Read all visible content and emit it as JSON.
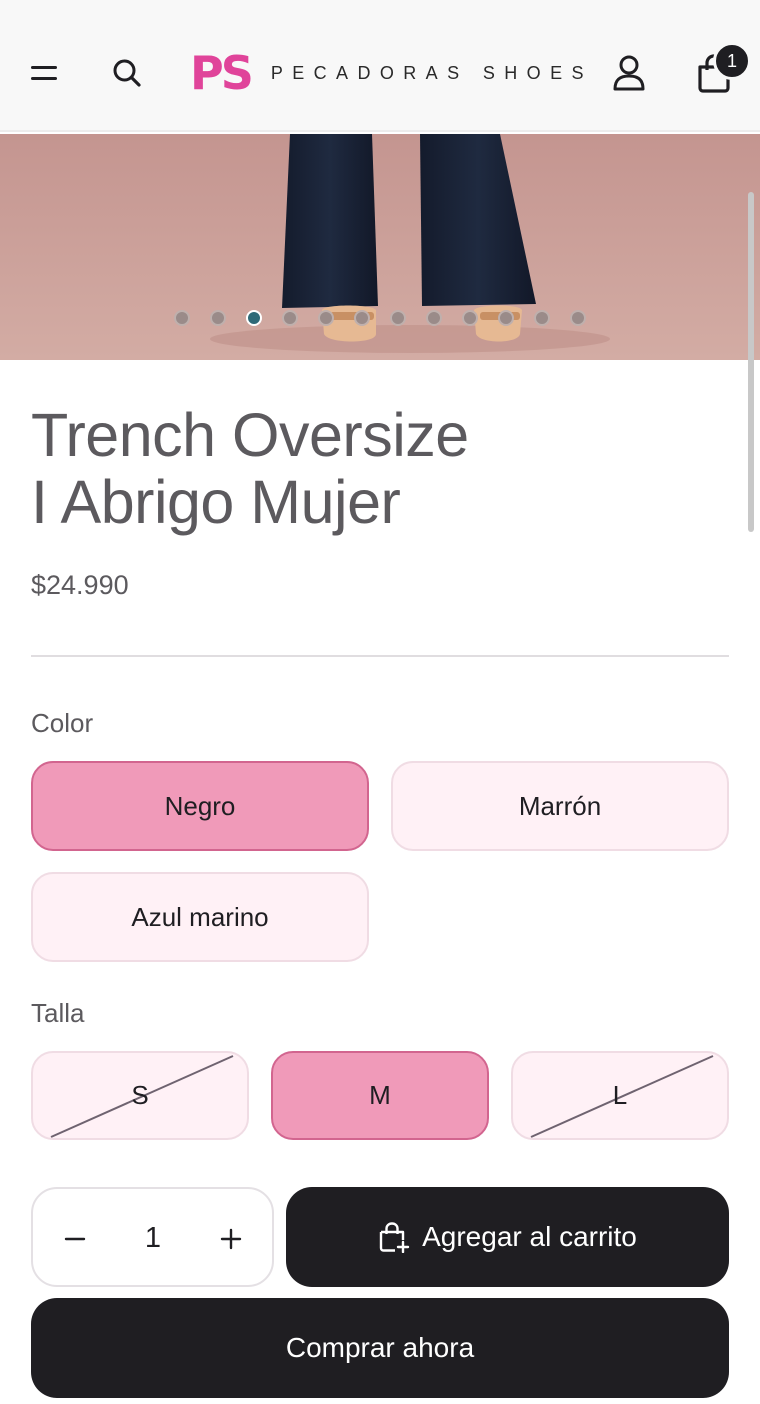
{
  "header": {
    "logo_mark": "PS",
    "logo_text": "PECADORAS SHOES",
    "cart_count": "1",
    "icons": {
      "menu": "hamburger-menu-icon",
      "search": "search-icon",
      "account": "user-account-icon",
      "cart": "shopping-bag-icon"
    }
  },
  "gallery": {
    "image_count": 12,
    "active_index": 2
  },
  "product": {
    "title_line1": "Trench Oversize",
    "title_line2": "I Abrigo Mujer",
    "price": "$24.990"
  },
  "color_option": {
    "label": "Color",
    "values": [
      "Negro",
      "Marrón",
      "Azul marino"
    ],
    "selected": "Negro"
  },
  "size_option": {
    "label": "Talla",
    "values": [
      "S",
      "M",
      "L"
    ],
    "selected": "M",
    "unavailable": [
      "S",
      "L"
    ]
  },
  "quantity": {
    "value": "1"
  },
  "actions": {
    "add_to_cart": "Agregar al carrito",
    "buy_now": "Comprar ahora"
  },
  "colors": {
    "brand": "#e0449a",
    "selected_option_bg": "#f09ab9",
    "option_bg": "#fff1f6",
    "dark_button": "#1f1e22"
  }
}
